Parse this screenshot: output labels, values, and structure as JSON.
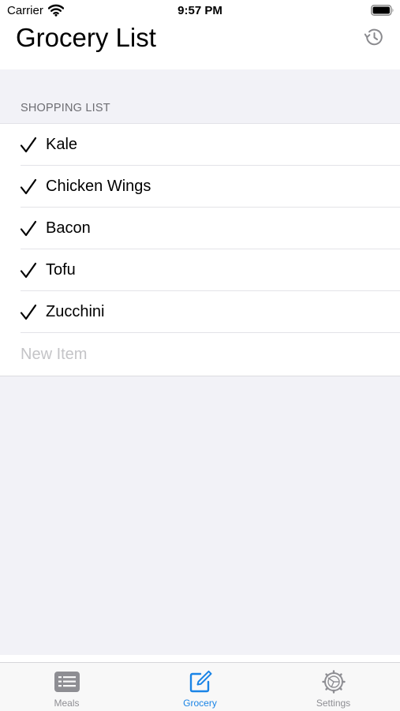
{
  "status_bar": {
    "carrier": "Carrier",
    "time": "9:57 PM"
  },
  "header": {
    "title": "Grocery List",
    "history_icon": "history-clock-icon"
  },
  "section": {
    "title": "SHOPPING LIST"
  },
  "items": [
    {
      "label": "Kale",
      "checked": true
    },
    {
      "label": "Chicken Wings",
      "checked": true
    },
    {
      "label": "Bacon",
      "checked": true
    },
    {
      "label": "Tofu",
      "checked": true
    },
    {
      "label": "Zucchini",
      "checked": true
    }
  ],
  "new_item": {
    "placeholder": "New Item",
    "value": ""
  },
  "tab_bar": {
    "tabs": [
      {
        "label": "Meals",
        "icon": "meals-list-icon",
        "active": false
      },
      {
        "label": "Grocery",
        "icon": "compose-icon",
        "active": true
      },
      {
        "label": "Settings",
        "icon": "gear-icon",
        "active": false
      }
    ]
  },
  "colors": {
    "accent": "#1a84e6",
    "inactive_tab": "#8e8e93",
    "background": "#f2f2f7",
    "section_header": "#6d6d72",
    "placeholder": "#c4c4c7"
  }
}
